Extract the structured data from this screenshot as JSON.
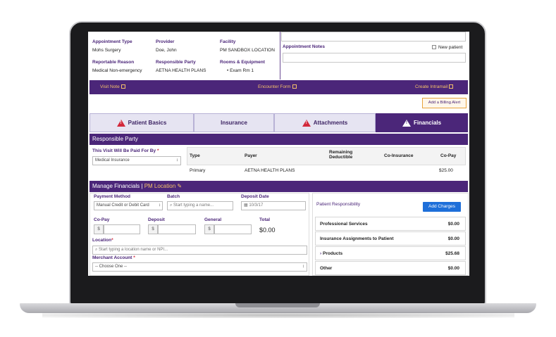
{
  "appointment": {
    "type_label": "Appointment Type",
    "type_value": "Mohs Surgery",
    "provider_label": "Provider",
    "provider_value": "Doe, John",
    "facility_label": "Facility",
    "facility_value": "PM SANDBOX LOCATION",
    "reason_label": "Reportable Reason",
    "reason_value": "Medical Non-emergency",
    "party_label": "Responsible Party",
    "party_value": "AETNA HEALTH PLANS",
    "rooms_label": "Rooms & Equipment",
    "rooms_value": "Exam Rm 1",
    "notes_label": "Appointment Notes",
    "new_patient_label": "New patient"
  },
  "links_bar": {
    "visit_note": "Visit Note",
    "encounter_form": "Encounter Form",
    "create_intramail": "Create Intramail"
  },
  "billing_alert": "Add a Billing Alert",
  "tabs": [
    {
      "label": "Patient Basics",
      "warn": true
    },
    {
      "label": "Insurance",
      "warn": false
    },
    {
      "label": "Attachments",
      "warn": true
    },
    {
      "label": "Financials",
      "warn": true
    }
  ],
  "responsible_party": {
    "header": "Responsible Party",
    "paid_by_label": "This Visit Will Be Paid For By",
    "paid_by_value": "Medical Insurance",
    "columns": [
      "Type",
      "Payer",
      "Remaining Deductible",
      "Co-Insurance",
      "Co-Pay"
    ],
    "rows": [
      {
        "type": "Primary",
        "payer": "AETNA HEALTH PLANS",
        "deductible": "",
        "coinsurance": "",
        "copay": "$25.00"
      }
    ]
  },
  "manage_financials": {
    "header": "Manage Financials",
    "location_link": "PM Location",
    "payment_method_label": "Payment Method",
    "payment_method_value": "Manual Credit or Debit Card",
    "batch_label": "Batch",
    "batch_placeholder": "Start typing a name...",
    "deposit_date_label": "Deposit Date",
    "deposit_date_value": "10/3/17",
    "copay_label": "Co-Pay",
    "deposit_label": "Deposit",
    "general_label": "General",
    "total_label": "Total",
    "total_value": "$0.00",
    "currency": "$",
    "location_label": "Location",
    "location_placeholder": "Start typing a location name or NPI...",
    "merchant_label": "Merchant Account",
    "merchant_value": "-- Choose One --",
    "patient_resp_label": "Patient Responsibility",
    "add_charges": "Add Charges",
    "resp_rows": [
      {
        "label": "Professional Services",
        "amount": "$0.00"
      },
      {
        "label": "Insurance Assignments to Patient",
        "amount": "$0.00"
      },
      {
        "label": "Products",
        "amount": "$25.68"
      },
      {
        "label": "Other",
        "amount": "$0.00"
      }
    ]
  },
  "colors": {
    "primary": "#4b2679",
    "accent": "#f4c06a",
    "warning": "#d2283b",
    "button": "#1e6fd9"
  }
}
